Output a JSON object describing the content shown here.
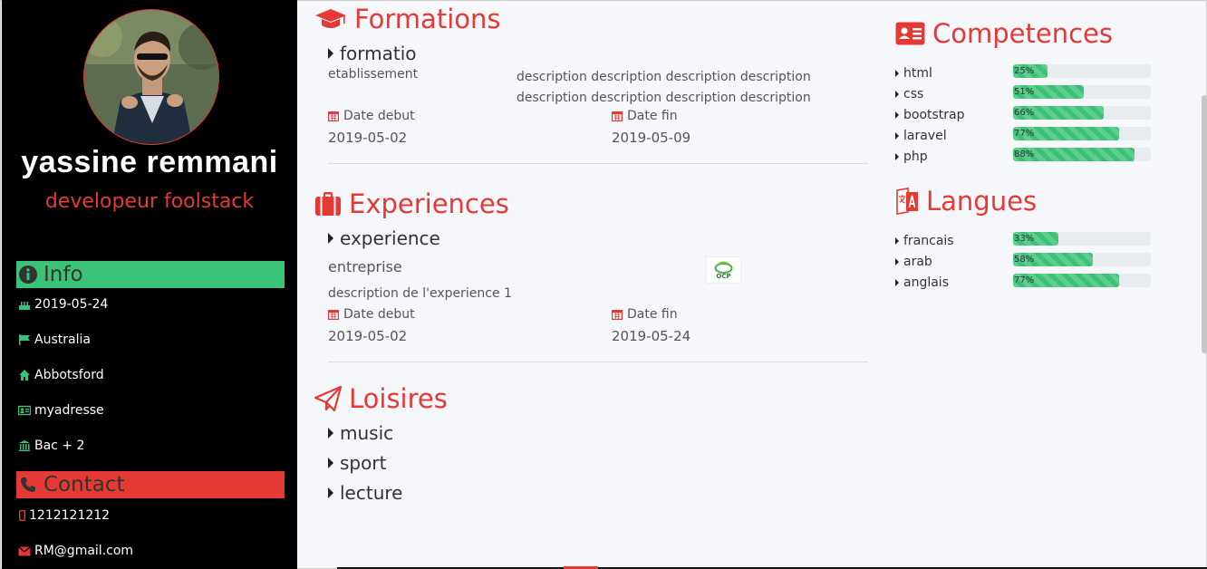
{
  "profile": {
    "name": "yassine  remmani",
    "role": "developeur foolstack"
  },
  "info": {
    "title": "Info",
    "items": [
      {
        "icon": "birthday-cake-icon",
        "text": "2019-05-24"
      },
      {
        "icon": "flag-icon",
        "text": "Australia"
      },
      {
        "icon": "home-icon",
        "text": "Abbotsford"
      },
      {
        "icon": "id-card-icon",
        "text": "myadresse"
      },
      {
        "icon": "university-icon",
        "text": "Bac + 2"
      }
    ]
  },
  "contact": {
    "title": "Contact",
    "items": [
      {
        "icon": "mobile-phone-icon",
        "text": "1212121212"
      },
      {
        "icon": "envelope-icon",
        "text": "RM@gmail.com"
      }
    ]
  },
  "formations": {
    "title": "Formations",
    "entry": {
      "name": "formatio",
      "establishment": "etablissement",
      "description": "description description description description description description description description",
      "start_label": "Date debut",
      "start": "2019-05-02",
      "end_label": "Date fin",
      "end": "2019-05-09"
    }
  },
  "experiences": {
    "title": "Experiences",
    "entry": {
      "name": "experience",
      "company": "entreprise",
      "logo_text": "OCP",
      "description": "description de l'experience 1",
      "start_label": "Date debut",
      "start": "2019-05-02",
      "end_label": "Date fin",
      "end": "2019-05-24"
    }
  },
  "loisirs": {
    "title": "Loisires",
    "items": [
      "music",
      "sport",
      "lecture"
    ]
  },
  "competences": {
    "title": "Competences",
    "items": [
      {
        "name": "html",
        "percent": 25,
        "label": "25%"
      },
      {
        "name": "css",
        "percent": 51,
        "label": "51%"
      },
      {
        "name": "bootstrap",
        "percent": 66,
        "label": "66%"
      },
      {
        "name": "laravel",
        "percent": 77,
        "label": "77%"
      },
      {
        "name": "php",
        "percent": 88,
        "label": "88%"
      }
    ]
  },
  "langues": {
    "title": "Langues",
    "items": [
      {
        "name": "francais",
        "percent": 33,
        "label": "33%"
      },
      {
        "name": "arab",
        "percent": 58,
        "label": "58%"
      },
      {
        "name": "anglais",
        "percent": 77,
        "label": "77%"
      }
    ]
  },
  "colors": {
    "accent_red": "#e53935",
    "accent_green": "#3ac276",
    "sidebar_bg": "#000000",
    "main_bg": "#f5f7fa"
  }
}
